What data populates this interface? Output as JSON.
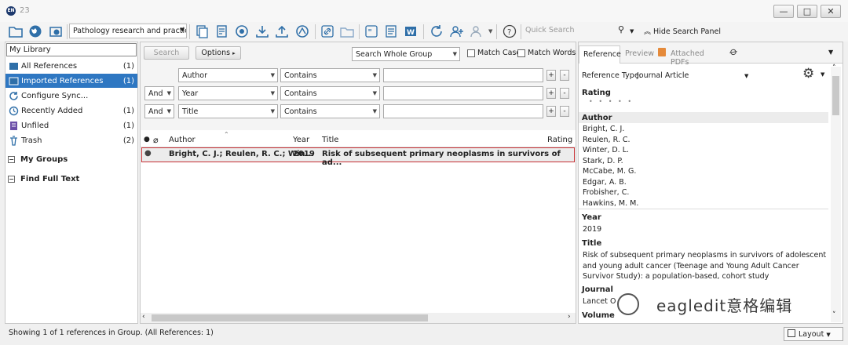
{
  "window": {
    "title": "23",
    "app_icon_text": "EN",
    "buttons": [
      "—",
      "□",
      "✕"
    ]
  },
  "toolbar": {
    "group_combo": "Pathology research and practice",
    "quick_search_placeholder": "Quick Search",
    "hide_search_panel": "Hide Search Panel"
  },
  "sidebar": {
    "my_library": "My Library",
    "items": [
      {
        "label": "All References",
        "count": "(1)",
        "icon": "references-icon",
        "selected": false
      },
      {
        "label": "Imported References",
        "count": "(1)",
        "icon": "imported-icon",
        "selected": true
      },
      {
        "label": "Configure Sync...",
        "count": "",
        "icon": "sync-icon",
        "selected": false
      },
      {
        "label": "Recently Added",
        "count": "(1)",
        "icon": "clock-icon",
        "selected": false
      },
      {
        "label": "Unfiled",
        "count": "(1)",
        "icon": "unfiled-icon",
        "selected": false
      },
      {
        "label": "Trash",
        "count": "(2)",
        "icon": "trash-icon",
        "selected": false
      }
    ],
    "groups": [
      "My Groups",
      "Find Full Text"
    ]
  },
  "search": {
    "search_button": "Search",
    "options_button": "Options",
    "scope": "Search Whole Group",
    "match_case": "Match Case",
    "match_words": "Match Words",
    "rows": [
      {
        "connector": "",
        "field": "Author",
        "operator": "Contains",
        "value": ""
      },
      {
        "connector": "And",
        "field": "Year",
        "operator": "Contains",
        "value": ""
      },
      {
        "connector": "And",
        "field": "Title",
        "operator": "Contains",
        "value": ""
      }
    ]
  },
  "list": {
    "columns": {
      "author": "Author",
      "year": "Year",
      "title": "Title",
      "rating": "Rating"
    },
    "rows": [
      {
        "author": "Bright, C. J.; Reulen, R. C.; Win...",
        "year": "2019",
        "title": "Risk of subsequent primary neoplasms in survivors of ad..."
      }
    ]
  },
  "detail": {
    "tabs": [
      "Reference",
      "Preview",
      "Attached PDFs"
    ],
    "ref_type_label": "Reference Type:",
    "ref_type": "Journal Article",
    "rating_label": "Rating",
    "rating_dots": "•   •   •   •   •",
    "author_label": "Author",
    "authors": [
      "Bright, C. J.",
      "Reulen, R. C.",
      "Winter, D. L.",
      "Stark, D. P.",
      "McCabe, M. G.",
      "Edgar, A. B.",
      "Frobisher, C.",
      "Hawkins, M. M."
    ],
    "year_label": "Year",
    "year": "2019",
    "title_label": "Title",
    "title": "Risk of subsequent primary neoplasms in survivors of adolescent and young adult cancer (Teenage and Young Adult Cancer Survivor Study): a population-based, cohort study",
    "journal_label": "Journal",
    "journal": "Lancet O",
    "volume_label": "Volume"
  },
  "status": {
    "text": "Showing 1 of 1 references in Group. (All References: 1)",
    "layout": "Layout"
  },
  "watermark": "eagledit意格编辑",
  "colors": {
    "selection": "#2e77c2",
    "highlight_border": "#c63034",
    "toolbar_icon": "#2f6fa8"
  }
}
